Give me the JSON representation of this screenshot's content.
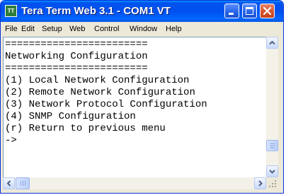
{
  "window": {
    "title": "Tera Term Web 3.1 - COM1 VT",
    "app_icon_text": "TT"
  },
  "menu": [
    {
      "label": "File"
    },
    {
      "label": "Edit"
    },
    {
      "label": "Setup"
    },
    {
      "label": "Web"
    },
    {
      "label": "Control"
    },
    {
      "label": "Window"
    },
    {
      "label": "Help"
    }
  ],
  "terminal": {
    "lines": [
      "========================",
      "Networking Configuration",
      "========================",
      "(1) Local Network Configuration",
      "(2) Remote Network Configuration",
      "(3) Network Protocol Configuration",
      "(4) SNMP Configuration",
      "(r) Return to previous menu",
      "->"
    ]
  },
  "colors": {
    "title_bar": "#0053EE",
    "window_frame": "#ECE9D8",
    "close_button": "#D9562F"
  }
}
